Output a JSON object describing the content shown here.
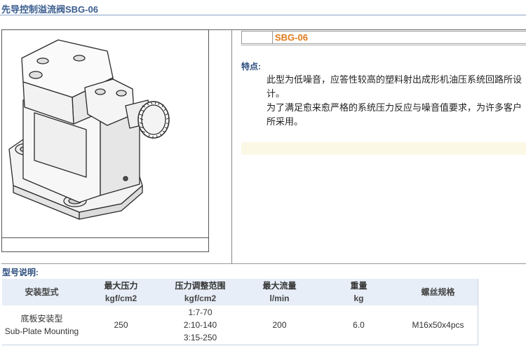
{
  "page": {
    "title": "先导控制溢流阀SBG-06"
  },
  "product": {
    "model": "SBG-06"
  },
  "features": {
    "heading": "特点:",
    "paragraph1": "此型为低噪音，应答性较高的塑料射出成形机油压系统回路所设计。",
    "paragraph2": "为了满足愈来愈严格的系统压力反应与噪音值要求，为许多客户所采用。"
  },
  "spec": {
    "heading": "型号说明:",
    "headers": [
      {
        "name": "安装型式",
        "unit": ""
      },
      {
        "name": "最大压力",
        "unit": "kgf/cm2"
      },
      {
        "name": "压力调整范围",
        "unit": "kgf/cm2"
      },
      {
        "name": "最大流量",
        "unit": "l/min"
      },
      {
        "name": "重量",
        "unit": "kg"
      },
      {
        "name": "螺丝规格",
        "unit": ""
      }
    ],
    "row": {
      "type_cn": "底板安装型",
      "type_en": "Sub-Plate Mounting",
      "max_pressure": "250",
      "ranges": [
        "1:7-70",
        "2:10-140",
        "3:15-250"
      ],
      "max_flow": "200",
      "weight": "6.0",
      "screw": "M16x50x4pcs"
    }
  }
}
